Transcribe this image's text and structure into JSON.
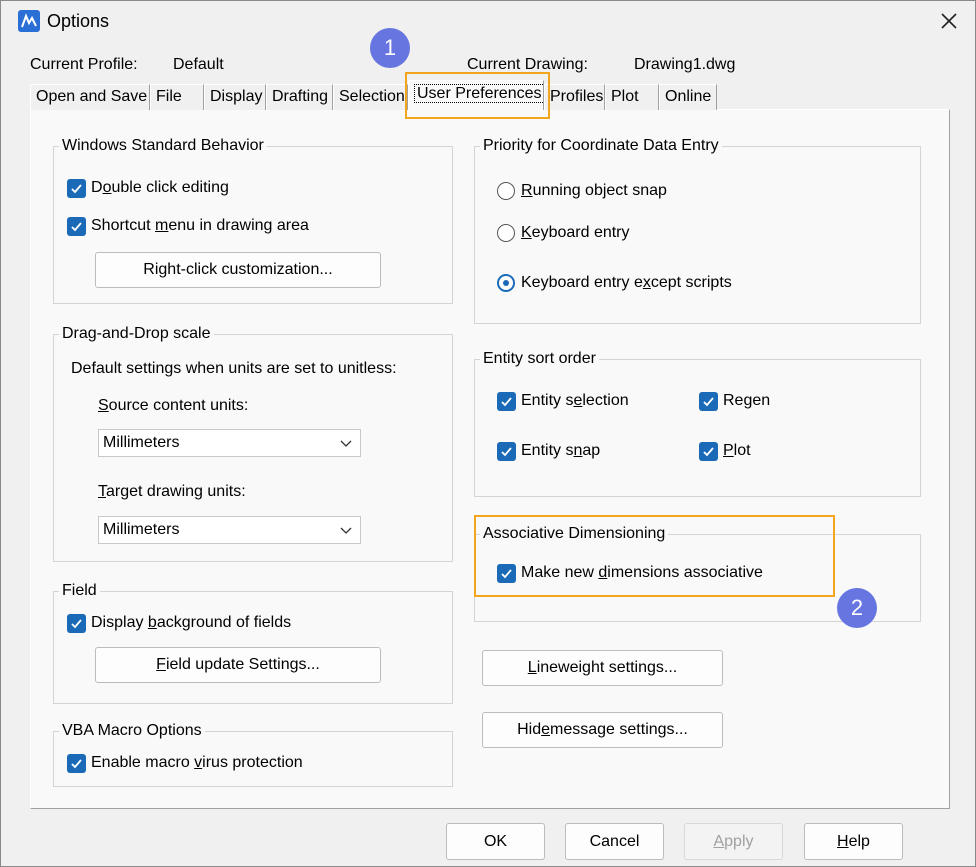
{
  "window": {
    "title": "Options",
    "close_glyph": "✕"
  },
  "profile": {
    "current_profile_label": "Current Profile:",
    "current_profile_value": "Default",
    "current_drawing_label": "Current Drawing:",
    "current_drawing_value": "Drawing1.dwg"
  },
  "tabs": [
    "Open and Save",
    "File",
    "Display",
    "Drafting",
    "Selection",
    "User Preferences",
    "Profiles",
    "Plot",
    "Online"
  ],
  "active_tab": "User Preferences",
  "windows_standard": {
    "title": "Windows Standard Behavior",
    "double_click": {
      "pre": "D",
      "ul": "o",
      "post": "uble click editing",
      "checked": true
    },
    "shortcut_menu": {
      "pre": "Shortcut ",
      "ul": "m",
      "post": "enu in drawing area",
      "checked": true
    },
    "right_click_button": "Right-click customization..."
  },
  "drag_drop": {
    "title": "Drag-and-Drop scale",
    "description": "Default settings when units are set to unitless:",
    "source_label": {
      "pre": "",
      "ul": "S",
      "post": "ource content units:"
    },
    "source_value": "Millimeters",
    "target_label": {
      "pre": "",
      "ul": "T",
      "post": "arget drawing units:"
    },
    "target_value": "Millimeters"
  },
  "field": {
    "title": "Field",
    "display_background": {
      "pre": "Display ",
      "ul": "b",
      "post": "ackground of fields",
      "checked": true
    },
    "update_button": {
      "pre": "",
      "ul": "F",
      "post": "ield update Settings..."
    }
  },
  "vba": {
    "title": "VBA Macro Options",
    "enable_protection": {
      "pre": "Enable macro ",
      "ul": "v",
      "post": "irus protection",
      "checked": true
    }
  },
  "priority": {
    "title": "Priority for Coordinate Data Entry",
    "running_snap": {
      "pre": "",
      "ul": "R",
      "post": "unning object snap",
      "selected": false
    },
    "keyboard_entry": {
      "pre": "",
      "ul": "K",
      "post": "eyboard entry",
      "selected": false
    },
    "keyboard_except": {
      "pre": "Keyboard entry e",
      "ul": "x",
      "post": "cept scripts",
      "selected": true
    }
  },
  "entity_sort": {
    "title": "Entity sort order",
    "entity_selection": {
      "pre": "Entity s",
      "ul": "e",
      "post": "lection",
      "checked": true
    },
    "regen": {
      "pre": "Re",
      "ul": "g",
      "post": "en",
      "checked": true
    },
    "entity_snap": {
      "pre": "Entity s",
      "ul": "n",
      "post": "ap",
      "checked": true
    },
    "plot": {
      "pre": "",
      "ul": "P",
      "post": "lot",
      "checked": true
    }
  },
  "assoc_dim": {
    "title": "Associative Dimensioning",
    "make_assoc": {
      "pre": "Make new ",
      "ul": "d",
      "post": "imensions associative",
      "checked": true
    }
  },
  "lineweight_button": {
    "pre": "",
    "ul": "L",
    "post": "ineweight settings..."
  },
  "hide_message_button": {
    "pre": "Hid",
    "ul": "e",
    "post": " message settings..."
  },
  "footer": {
    "ok": "OK",
    "cancel": "Cancel",
    "apply": {
      "pre": "",
      "ul": "A",
      "post": "pply"
    },
    "help": {
      "pre": "",
      "ul": "H",
      "post": "elp"
    }
  },
  "annotations": {
    "badge_1": "1",
    "badge_2": "2",
    "highlight_color": "#f2a61d",
    "badge_color": "#6675e0"
  },
  "colors": {
    "checkbox": "#1a6ab8",
    "panel_bg": "#f9f9f9",
    "dialog_bg": "#f0f0f0"
  }
}
